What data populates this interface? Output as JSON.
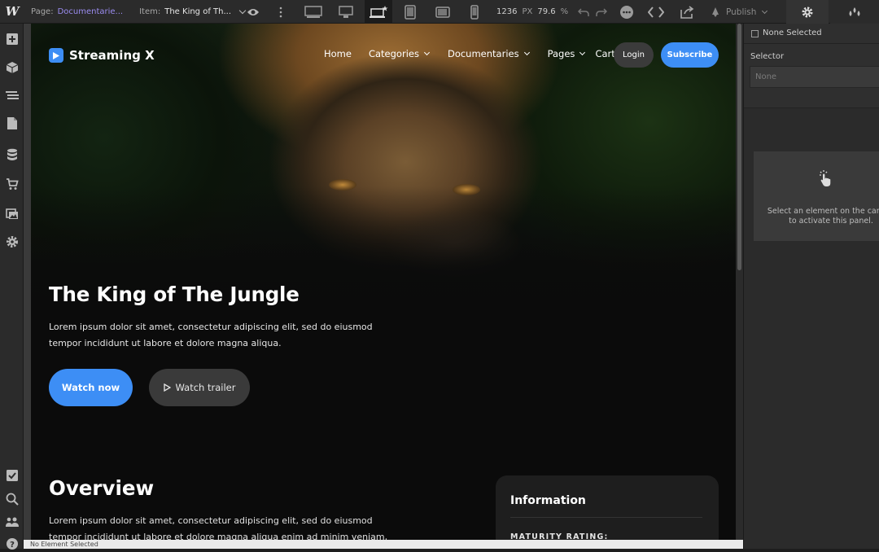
{
  "topbar": {
    "logo": "W",
    "page_label": "Page:",
    "page_value": "Documentarie...",
    "item_label": "Item:",
    "item_value": "The King of Th...",
    "canvas_width": "1236",
    "canvas_unit": "PX",
    "zoom_value": "79.6",
    "zoom_unit": "%",
    "publish_label": "Publish",
    "icons": [
      "preview-eye-icon",
      "more-vertical-icon",
      "desktop-large-icon",
      "desktop-icon",
      "laptop-star-icon",
      "tablet-icon",
      "tablet-landscape-icon",
      "phone-icon",
      "undo-icon",
      "redo-icon",
      "comments-icon",
      "code-icon",
      "export-icon",
      "publish-rocket-icon",
      "gear-icon",
      "drops-icon"
    ]
  },
  "leftbar": {
    "icons": [
      "add-icon",
      "components-icon",
      "navigator-icon",
      "pages-icon",
      "cms-icon",
      "ecommerce-icon",
      "assets-icon",
      "settings-icon",
      "audit-icon",
      "search-icon",
      "users-icon",
      "help-icon"
    ]
  },
  "site": {
    "brand": "Streaming X",
    "nav": [
      {
        "label": "Home",
        "dropdown": false
      },
      {
        "label": "Categories",
        "dropdown": true
      },
      {
        "label": "Documentaries",
        "dropdown": true
      },
      {
        "label": "Pages",
        "dropdown": true
      },
      {
        "label": "Cart",
        "dropdown": false
      }
    ],
    "login_label": "Login",
    "subscribe_label": "Subscribe",
    "hero_title": "The King of The Jungle",
    "hero_desc": "Lorem ipsum dolor sit amet, consectetur adipiscing elit, sed do eiusmod tempor incididunt ut labore et dolore magna aliqua.",
    "watch_now": "Watch now",
    "watch_trailer": "Watch trailer",
    "overview_title": "Overview",
    "overview_desc": "Lorem ipsum dolor sit amet, consectetur adipiscing elit, sed do eiusmod tempor incididunt ut labore et dolore magna aliqua enim ad minim veniam, quis nostrud",
    "info_title": "Information",
    "info_label": "MATURITY RATING:"
  },
  "bottombar": {
    "text": "No Element Selected"
  },
  "rightpanel": {
    "none_selected": "None Selected",
    "selector_label": "Selector",
    "selector_placeholder": "None",
    "empty_line1": "Select an element on the canvas",
    "empty_line2": "to activate this panel."
  },
  "colors": {
    "accent": "#3d8ef5",
    "page_link": "#9b8cf0",
    "login_bg": "#3b3b3b"
  }
}
